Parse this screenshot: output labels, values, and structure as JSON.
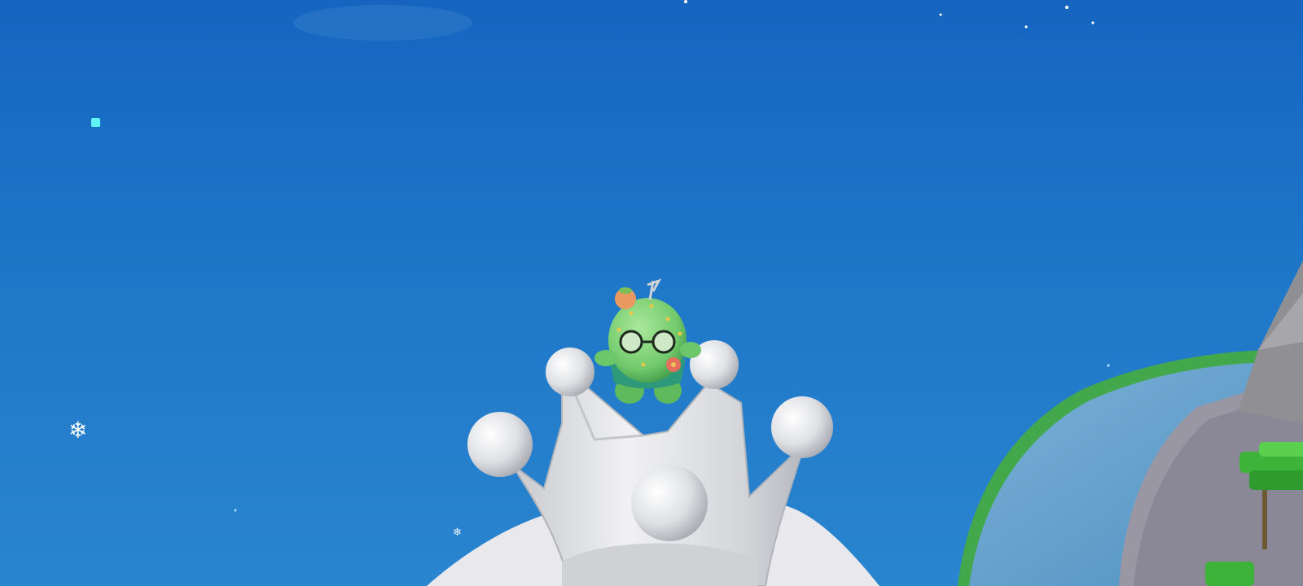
{
  "scene": {
    "description_colors": {
      "sky_top": "#1565c0",
      "sky_bottom": "#2a85cf",
      "crown": "#e6e6ea",
      "crown_shade": "#b9bcc2",
      "character_body": "#7fd07a",
      "character_dark": "#3f9a4a",
      "island_rim": "#43a84b",
      "pool_water": "#6aa3d6",
      "plaza": "#8d8a99"
    }
  },
  "hud": {
    "snow_icon": "snowflake-icon",
    "cyan_marker": "cyan-square-icon"
  }
}
